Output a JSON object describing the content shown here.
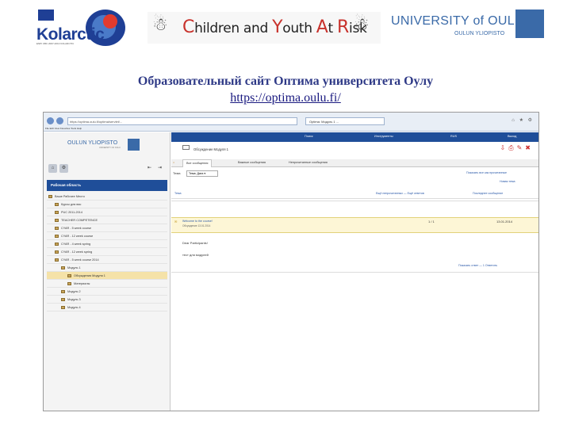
{
  "header": {
    "kolarctic": {
      "name": "Kolarctic",
      "subtitle": "ENPI CBC 2007-2013 KOLARCTIC"
    },
    "banner": {
      "part1": "C",
      "part2": "hildren and ",
      "part3": "Y",
      "part4": "outh ",
      "part5": "A",
      "part6": "t ",
      "part7": "R",
      "part8": "isk"
    },
    "university": {
      "name": "UNIVERSITY of OULU",
      "sub": "OULUN YLIOPISTO"
    }
  },
  "title": "Образовательный сайт Оптима университета Оулу",
  "link": "https://optima.oulu.fi/",
  "browser": {
    "url": "https://optima.oulu.fi/optima/servlet/...",
    "tab": "Optima: Модуль 1 ...",
    "menu": "File   Edit   View   Favorites   Tools   Help"
  },
  "sidebar": {
    "logo": "OULUN YLIOPISTO",
    "logo_sub": "UNIVERSITY OF OULU",
    "work_area": "Рабочая область",
    "items": [
      {
        "label": "Ваше Рабочее Место",
        "indent": 0,
        "selected": false
      },
      {
        "label": "Курсы для вас",
        "indent": 1,
        "selected": false
      },
      {
        "label": "PUC 2011-2014",
        "indent": 1,
        "selected": false
      },
      {
        "label": "TEACHER COMPETENCE",
        "indent": 1,
        "selected": false
      },
      {
        "label": "CYAR - 5 week course",
        "indent": 1,
        "selected": false
      },
      {
        "label": "CYAR - 12 week course",
        "indent": 1,
        "selected": false
      },
      {
        "label": "CYAR - 4 week spring",
        "indent": 1,
        "selected": false
      },
      {
        "label": "CYAR - 12 week spring",
        "indent": 1,
        "selected": false
      },
      {
        "label": "CYAR - 5 week course 2014",
        "indent": 1,
        "selected": false
      },
      {
        "label": "Модуль 1",
        "indent": 2,
        "selected": false
      },
      {
        "label": "Обсуждения Модуля 1",
        "indent": 3,
        "selected": true
      },
      {
        "label": "Материалы",
        "indent": 3,
        "selected": false
      },
      {
        "label": "Модуль 2",
        "indent": 2,
        "selected": false
      },
      {
        "label": "Модуль 3",
        "indent": 2,
        "selected": false
      },
      {
        "label": "Модуль 4",
        "indent": 2,
        "selected": false
      }
    ]
  },
  "main": {
    "top_nav": [
      "Поиск",
      "Инструменты",
      "RUS",
      "Выход"
    ],
    "breadcrumb": "Обсуждение Модуля 1",
    "tabs": [
      "Все сообщения",
      "Важные сообщения",
      "Непрочитанные сообщения"
    ],
    "filter_label": "Тема",
    "filter_value": "Тема: Дата ▾",
    "right_links": [
      "Показать все как прочитанные",
      "Новая тема"
    ],
    "col_topic": "Тема",
    "col_mid": "Ещё непрочитанных — Ещё ответов",
    "col_right": "Последнее сообщение",
    "message": {
      "title": "Welcome to the course!",
      "meta": "Обсуждение 13.01.2014",
      "count": "1 / 1",
      "date": "13.01.2014",
      "greeting": "Dear Participants!",
      "body": "тест для модулей",
      "actions": "Показать ответ — 1 Ответить"
    }
  }
}
